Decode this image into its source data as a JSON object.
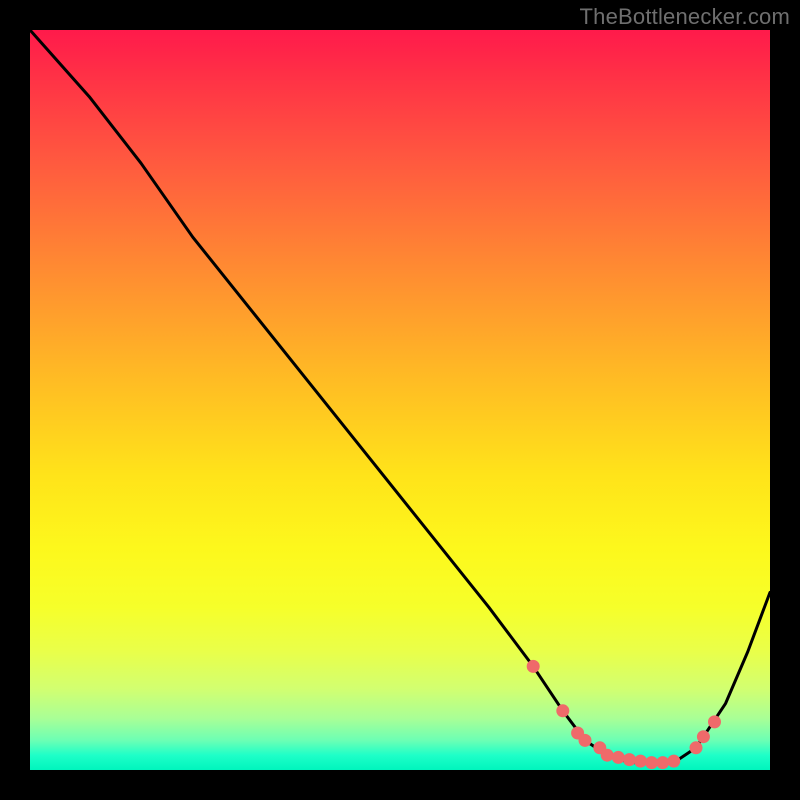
{
  "attribution": "TheBottlenecker.com",
  "colors": {
    "curve": "#000000",
    "point_fill": "#ef6a6a",
    "point_stroke": "#ef6a6a"
  },
  "chart_data": {
    "type": "line",
    "title": "",
    "xlabel": "",
    "ylabel": "",
    "xlim": [
      0,
      100
    ],
    "ylim": [
      0,
      100
    ],
    "grid": false,
    "series": [
      {
        "name": "curve",
        "x": [
          0,
          8,
          15,
          22,
          30,
          38,
          46,
          54,
          62,
          68,
          72,
          75,
          78,
          81,
          84,
          87,
          90,
          94,
          97,
          100
        ],
        "y": [
          100,
          91,
          82,
          72,
          62,
          52,
          42,
          32,
          22,
          14,
          8,
          4,
          2,
          1,
          1,
          1,
          3,
          9,
          16,
          24
        ]
      }
    ],
    "points": {
      "name": "markers",
      "x": [
        68,
        72,
        74,
        75,
        77,
        78,
        79.5,
        81,
        82.5,
        84,
        85.5,
        87,
        90,
        91,
        92.5
      ],
      "y": [
        14,
        8,
        5,
        4,
        3,
        2,
        1.7,
        1.4,
        1.2,
        1.0,
        1.0,
        1.2,
        3,
        4.5,
        6.5
      ]
    }
  }
}
